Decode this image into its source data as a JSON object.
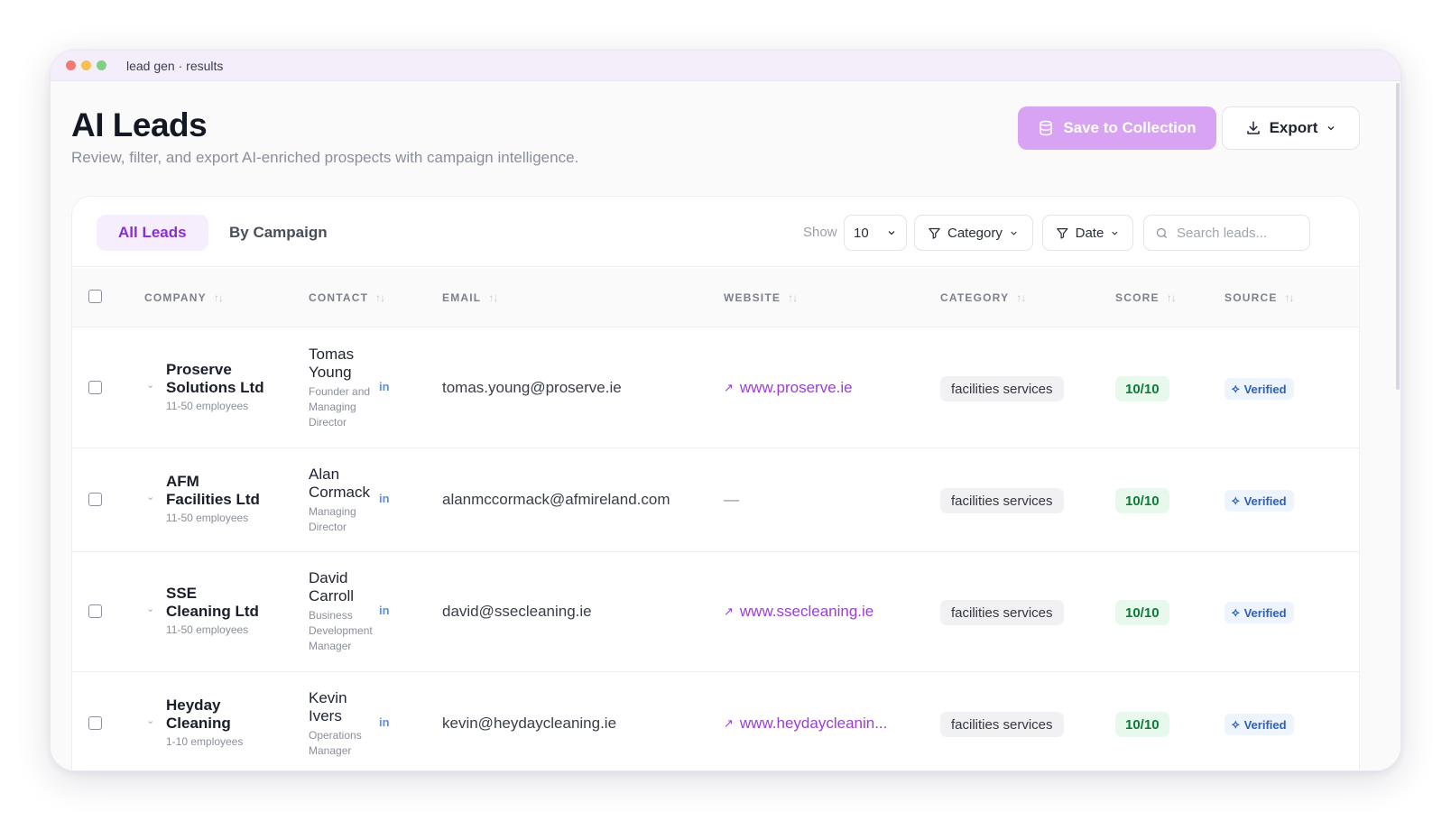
{
  "window": {
    "title": "lead gen · results"
  },
  "header": {
    "title": "AI Leads",
    "subtitle": "Review, filter, and export AI-enriched prospects with campaign intelligence.",
    "save_label": "Save to Collection",
    "export_label": "Export"
  },
  "toolbar": {
    "tabs": [
      {
        "label": "All Leads"
      },
      {
        "label": "By Campaign"
      }
    ],
    "show_label": "Show",
    "show_value": "10",
    "category_label": "Category",
    "date_label": "Date",
    "search_placeholder": "Search leads..."
  },
  "table": {
    "columns": [
      "COMPANY",
      "CONTACT",
      "EMAIL",
      "WEBSITE",
      "CATEGORY",
      "SCORE",
      "SOURCE"
    ],
    "rows": [
      {
        "company_lines": [
          "Proserve",
          "Solutions Ltd"
        ],
        "size": "11-50 employees",
        "contact_lines": [
          "Tomas",
          "Young"
        ],
        "role_lines": [
          "Founder and",
          "Managing",
          "Director"
        ],
        "email": "tomas.young@proserve.ie",
        "website": "www.proserve.ie",
        "category": "facilities services",
        "score": "10/10",
        "source": "Verified"
      },
      {
        "company_lines": [
          "AFM",
          "Facilities Ltd"
        ],
        "size": "11-50 employees",
        "contact_lines": [
          "Alan",
          "Cormack"
        ],
        "role_lines": [
          "Managing",
          "Director"
        ],
        "email": "alanmccormack@afmireland.com",
        "website": "—",
        "category": "facilities services",
        "score": "10/10",
        "source": "Verified"
      },
      {
        "company_lines": [
          "SSE",
          "Cleaning Ltd"
        ],
        "size": "11-50 employees",
        "contact_lines": [
          "David",
          "Carroll"
        ],
        "role_lines": [
          "Business",
          "Development",
          "Manager"
        ],
        "email": "david@ssecleaning.ie",
        "website": "www.ssecleaning.ie",
        "category": "facilities services",
        "score": "10/10",
        "source": "Verified"
      },
      {
        "company_lines": [
          "Heyday",
          "Cleaning"
        ],
        "size": "1-10 employees",
        "contact_lines": [
          "Kevin",
          "Ivers"
        ],
        "role_lines": [
          "Operations",
          "Manager"
        ],
        "email": "kevin@heydaycleaning.ie",
        "website": "www.heydaycleanin...",
        "category": "facilities services",
        "score": "10/10",
        "source": "Verified"
      }
    ]
  },
  "icons": {
    "linkedin": "in",
    "external_link": "↗",
    "sort": "↑↓",
    "chevron_down": "⌄",
    "verified": "⟡"
  },
  "colors": {
    "accent": "#8a2ed0",
    "save_button": "#d8a3f2",
    "link": "#9a3fd2",
    "score_bg": "#e7f8ec",
    "score_text": "#0f7a37",
    "verified_bg": "#eef4fe",
    "verified_text": "#2d5fb8"
  }
}
